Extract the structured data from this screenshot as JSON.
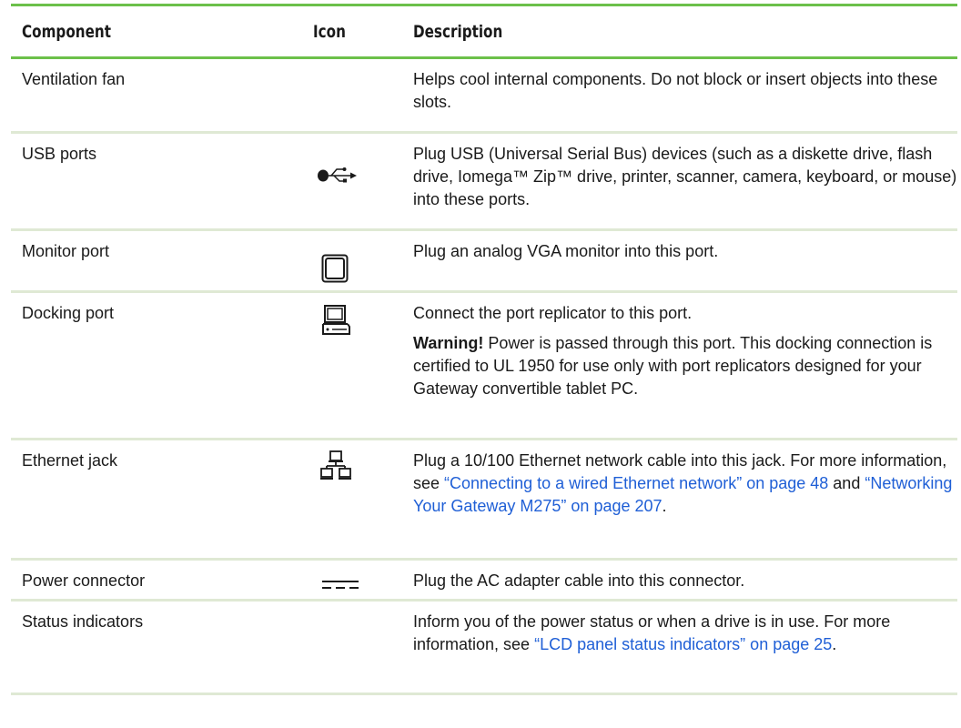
{
  "header": {
    "component": "Component",
    "icon": "Icon",
    "description": "Description"
  },
  "rows": [
    {
      "component": "Ventilation fan",
      "icon": "",
      "description": "Helps cool internal components. Do not block or insert objects into these slots."
    },
    {
      "component": "USB ports",
      "icon": "usb-icon",
      "description": "Plug USB (Universal Serial Bus) devices (such as a diskette drive, flash drive, Iomega™ Zip™ drive, printer, scanner, camera, keyboard, or mouse) into these ports."
    },
    {
      "component": "Monitor port",
      "icon": "monitor-icon",
      "description": "Plug an analog VGA monitor into this port."
    },
    {
      "component": "Docking port",
      "icon": "docking-icon",
      "description": "Connect the port replicator to this port.",
      "warning_label": "Warning!",
      "warning_text": " Power is passed through this port. This docking connection is certified to UL 1950 for use only with port replicators designed for your Gateway convertible tablet PC."
    },
    {
      "component": "Ethernet jack",
      "icon": "network-icon",
      "description_parts": [
        "Plug a 10/100 Ethernet network cable into this jack. For more information, see ",
        " and ",
        "."
      ],
      "links": [
        "“Connecting to a wired Ethernet network” on page 48",
        "“Networking Your Gateway M275” on page 207"
      ]
    },
    {
      "component": "Power connector",
      "icon": "dc-power-icon",
      "description": "Plug the AC adapter cable into this connector."
    },
    {
      "component": "Status indicators",
      "icon": "",
      "description_parts": [
        "Inform you of the power status or when a drive is in use. For more information, see ",
        "."
      ],
      "links": [
        "“LCD panel status indicators” on page 25"
      ]
    }
  ],
  "colors": {
    "rule": "#6cc04a",
    "row_divider": "#dfe9d4",
    "link": "#1f5fd6"
  }
}
